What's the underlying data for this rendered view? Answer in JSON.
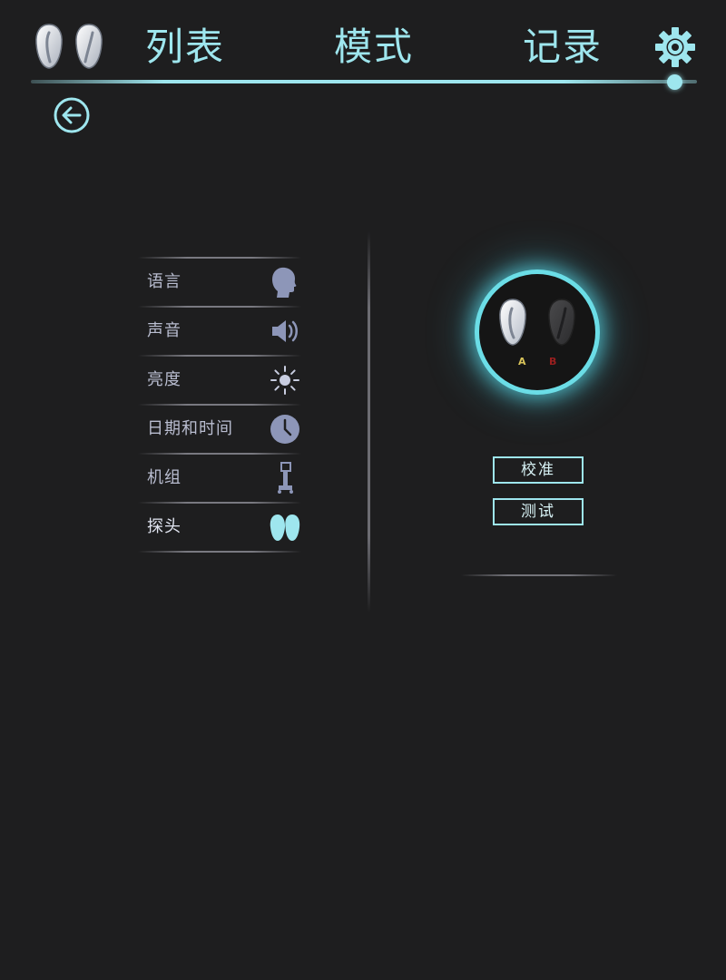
{
  "nav": {
    "items": [
      "列表",
      "模式",
      "记录"
    ]
  },
  "settings_menu": {
    "items": [
      {
        "label": "语言",
        "icon": "head-profile-icon"
      },
      {
        "label": "声音",
        "icon": "speaker-icon"
      },
      {
        "label": "亮度",
        "icon": "brightness-sun-icon"
      },
      {
        "label": "日期和时间",
        "icon": "clock-icon"
      },
      {
        "label": "机组",
        "icon": "cart-unit-icon"
      },
      {
        "label": "探头",
        "icon": "probes-icon",
        "active": true
      }
    ]
  },
  "probe_panel": {
    "probe_a": "A",
    "probe_b": "B",
    "calibrate_label": "校准",
    "test_label": "测试"
  },
  "colors": {
    "accent": "#9ee6ee",
    "background": "#1e1e1f",
    "menu_icon": "#8d96b8",
    "probe_a_label": "#d8c35a",
    "probe_b_label": "#9a1f1f"
  }
}
